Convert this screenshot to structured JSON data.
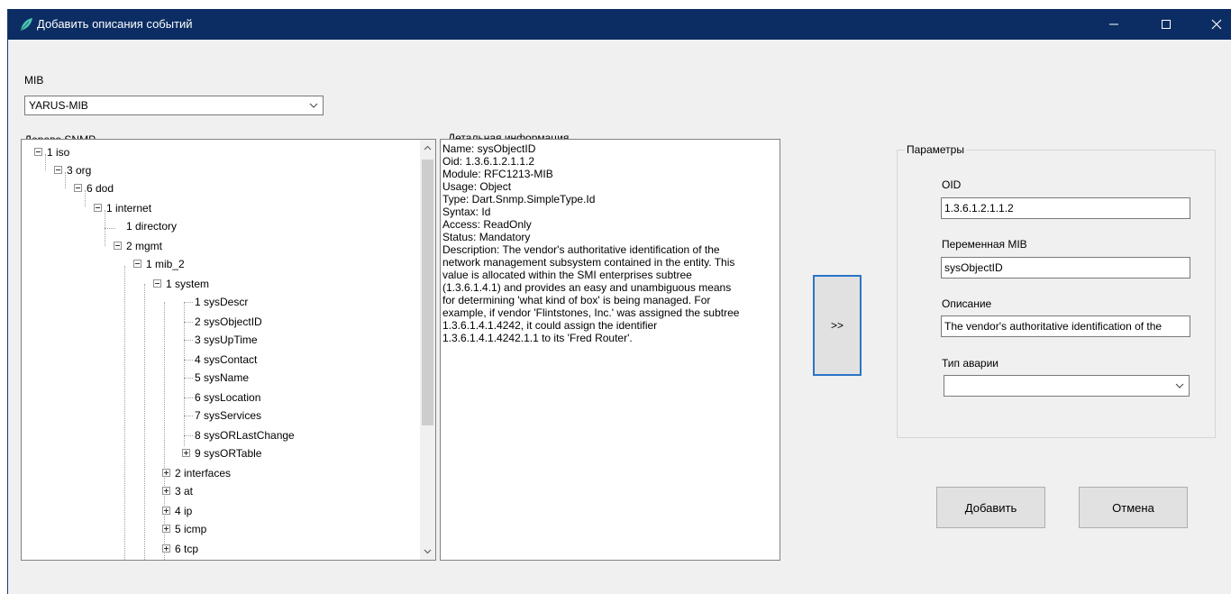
{
  "window": {
    "title": "Добавить описания событий",
    "controls": {
      "minimize": "—",
      "maximize": "☐",
      "close": "✕"
    }
  },
  "mib": {
    "label": "MIB",
    "selected": "YARUS-MIB"
  },
  "tree": {
    "label": "Дерево SNMP",
    "nodes": [
      "1 iso",
      "3 org",
      "6 dod",
      "1 internet",
      "1 directory",
      "2 mgmt",
      "1 mib_2",
      "1 system",
      "1 sysDescr",
      "2 sysObjectID",
      "3 sysUpTime",
      "4 sysContact",
      "5 sysName",
      "6 sysLocation",
      "7 sysServices",
      "8 sysORLastChange",
      "9 sysORTable",
      "2 interfaces",
      "3 at",
      "4 ip",
      "5 icmp",
      "6 tcp"
    ]
  },
  "detail": {
    "label": "Детальная информация",
    "lines": [
      "Name: sysObjectID",
      "Oid: 1.3.6.1.2.1.1.2",
      "Module: RFC1213-MIB",
      "Usage: Object",
      "Type: Dart.Snmp.SimpleType.Id",
      "Syntax: Id",
      "Access: ReadOnly",
      "Status: Mandatory",
      "Description: The vendor's authoritative identification of the",
      "network management subsystem contained in the entity. This",
      "value is allocated within the SMI enterprises subtree",
      "(1.3.6.1.4.1) and provides an easy and unambiguous means",
      "for determining 'what kind of box' is being managed. For",
      "example, if vendor 'Flintstones, Inc.' was assigned the subtree",
      "1.3.6.1.4.1.4242, it could assign the identifier",
      "1.3.6.1.4.1.4242.1.1 to its 'Fred Router'."
    ]
  },
  "transfer_button": ">>",
  "params": {
    "title": "Параметры",
    "oid_label": "OID",
    "oid_value": "1.3.6.1.2.1.1.2",
    "var_label": "Переменная MIB",
    "var_value": "sysObjectID",
    "desc_label": "Описание",
    "desc_value": "The vendor's authoritative identification of the",
    "alarm_label": "Тип аварии",
    "alarm_value": ""
  },
  "buttons": {
    "add": "Добавить",
    "cancel": "Отмена"
  },
  "colors": {
    "titlebar": "#0b2d63",
    "accent_border": "#2b74c7"
  }
}
